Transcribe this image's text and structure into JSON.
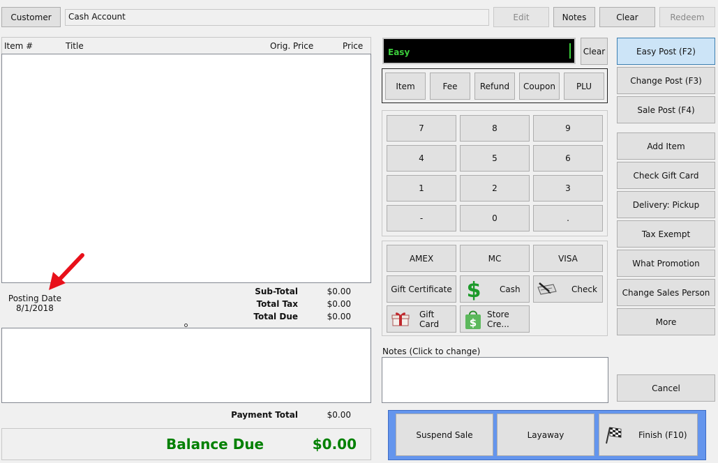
{
  "topbar": {
    "customer_label": "Customer",
    "account_value": "Cash Account",
    "edit_label": "Edit",
    "notes_label": "Notes",
    "clear_label": "Clear",
    "redeem_label": "Redeem"
  },
  "items_table": {
    "columns": [
      "Item #",
      "Title",
      "Orig. Price",
      "Price"
    ]
  },
  "posting": {
    "label": "Posting Date",
    "date": "8/1/2018"
  },
  "totals": {
    "subtotal_label": "Sub-Total",
    "subtotal_value": "$0.00",
    "tax_label": "Total Tax",
    "tax_value": "$0.00",
    "due_label": "Total Due",
    "due_value": "$0.00",
    "payment_label": "Payment Total",
    "payment_value": "$0.00",
    "balance_label": "Balance Due",
    "balance_value": "$0.00"
  },
  "entry": {
    "mode_text": "Easy",
    "clear_label": "Clear",
    "types": [
      "Item",
      "Fee",
      "Refund",
      "Coupon",
      "PLU"
    ]
  },
  "keypad": [
    "7",
    "8",
    "9",
    "4",
    "5",
    "6",
    "1",
    "2",
    "3",
    "-",
    "0",
    "."
  ],
  "payments": {
    "amex": "AMEX",
    "mc": "MC",
    "visa": "VISA",
    "gift_certificate": "Gift Certificate",
    "cash": "Cash",
    "check": "Check",
    "gift_card": "Gift Card",
    "store_credit": "Store Cre..."
  },
  "notes": {
    "label": "Notes (Click to change)"
  },
  "actions": {
    "suspend": "Suspend Sale",
    "layaway": "Layaway",
    "finish": "Finish (F10)"
  },
  "sidebar": {
    "easy_post": "Easy Post (F2)",
    "change_post": "Change Post (F3)",
    "sale_post": "Sale Post (F4)",
    "add_item": "Add Item",
    "check_gift_card": "Check Gift Card",
    "delivery": "Delivery: Pickup",
    "tax_exempt": "Tax Exempt",
    "what_promotion": "What Promotion",
    "change_sales_person": "Change Sales Person",
    "more": "More",
    "cancel": "Cancel"
  },
  "colors": {
    "green": "#008000",
    "accent_blue": "#6495ed",
    "active_blue": "#cce4f7"
  }
}
